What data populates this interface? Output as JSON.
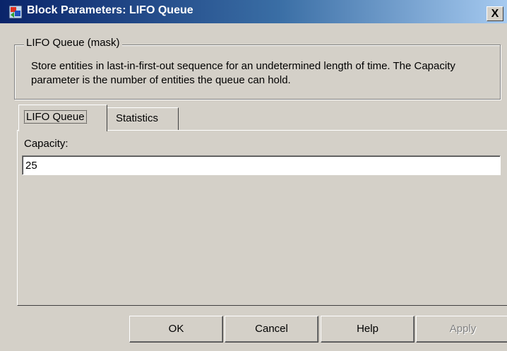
{
  "window": {
    "title": "Block Parameters: LIFO Queue",
    "close_label": "X"
  },
  "group": {
    "legend": "LIFO Queue (mask)",
    "description": "Store entities in last-in-first-out sequence for an undetermined length of time. The Capacity parameter is the number of entities the queue can hold."
  },
  "tabs": [
    {
      "label": "LIFO Queue",
      "active": true
    },
    {
      "label": "Statistics",
      "active": false
    }
  ],
  "form": {
    "capacity_label": "Capacity:",
    "capacity_value": "25"
  },
  "buttons": {
    "ok": "OK",
    "cancel": "Cancel",
    "help": "Help",
    "apply": "Apply",
    "apply_enabled": false
  },
  "colors": {
    "titlebar_start": "#0a246a",
    "titlebar_end": "#a6caf0",
    "face": "#d4d0c8"
  }
}
